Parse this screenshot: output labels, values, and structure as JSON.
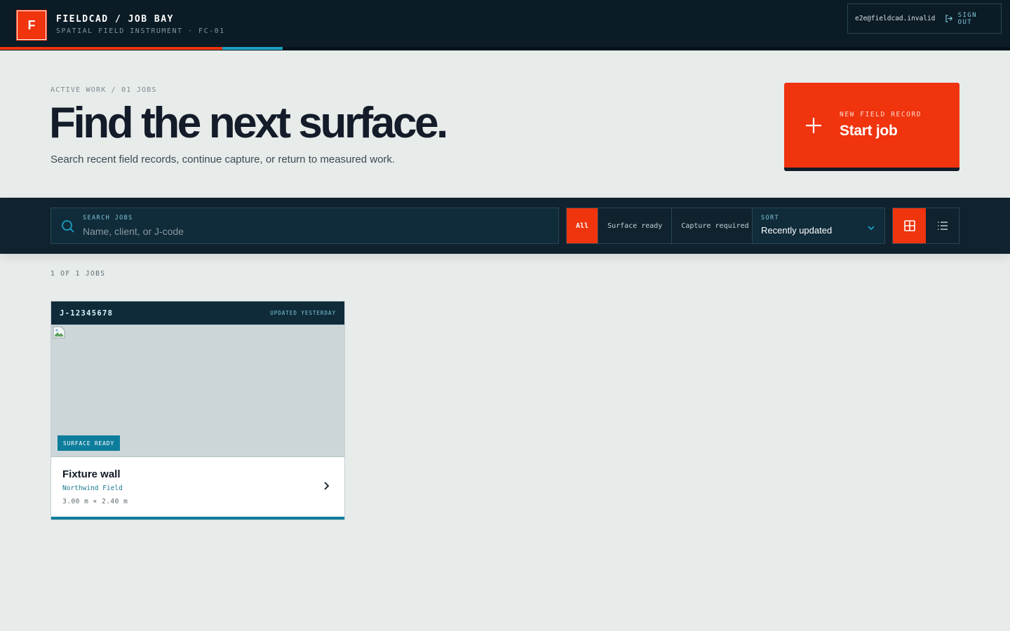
{
  "header": {
    "logo_letter": "F",
    "title": "FIELDCAD / JOB BAY",
    "subtitle": "SPATIAL FIELD INSTRUMENT · FC-01",
    "user_email": "e2e@fieldcad.invalid",
    "signout_label": "SIGN OUT"
  },
  "hero": {
    "meta": "ACTIVE WORK / 01 JOBS",
    "title": "Find the next surface.",
    "description": "Search recent field records, continue capture, or return to measured work.",
    "start_kicker": "NEW FIELD RECORD",
    "start_label": "Start job"
  },
  "toolbar": {
    "search_label": "SEARCH JOBS",
    "search_placeholder": "Name, client, or J-code",
    "search_value": "",
    "filters": [
      {
        "label": "All",
        "active": true
      },
      {
        "label": "Surface ready",
        "active": false
      },
      {
        "label": "Capture required",
        "active": false
      }
    ],
    "sort_label": "SORT",
    "sort_value": "Recently updated",
    "view_mode": "grid"
  },
  "results": {
    "count_label": "1 OF 1 JOBS",
    "jobs": [
      {
        "code": "J-12345678",
        "updated": "UPDATED YESTERDAY",
        "status": "SURFACE READY",
        "title": "Fixture wall",
        "client": "Northwind Field",
        "dimensions": "3.00 m × 2.40 m"
      }
    ]
  },
  "colors": {
    "accent": "#ef340e",
    "navy": "#0c1c26",
    "teal": "#0e7d9c",
    "cyan": "#1aa1c4",
    "background": "#e7ebea"
  }
}
